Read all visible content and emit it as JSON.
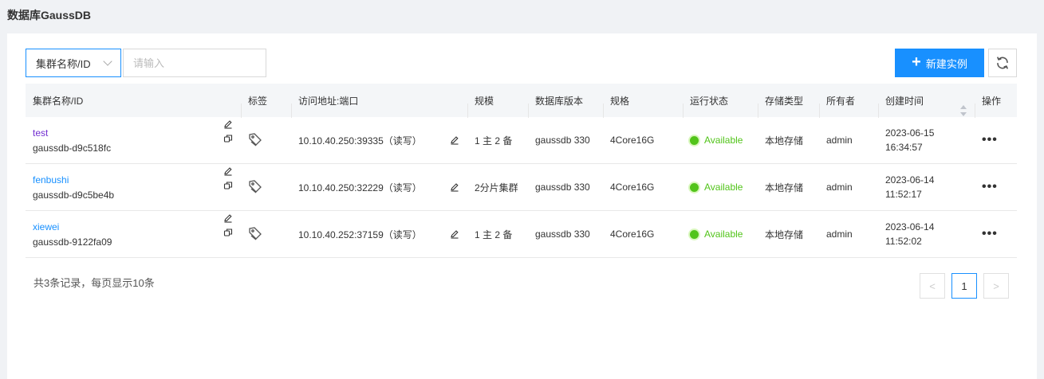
{
  "page": {
    "title": "数据库GaussDB"
  },
  "toolbar": {
    "filter_select": "集群名称/ID",
    "search_placeholder": "请输入",
    "create_label": "新建实例"
  },
  "table": {
    "headers": [
      "集群名称/ID",
      "标签",
      "访问地址:端口",
      "规模",
      "数据库版本",
      "规格",
      "运行状态",
      "存储类型",
      "所有者",
      "创建时间",
      "操作"
    ],
    "rows": [
      {
        "name": "test",
        "id": "gaussdb-d9c518fc",
        "address": "10.10.40.250:39335（读写）",
        "scale": "1 主 2 备",
        "version": "gaussdb 330",
        "spec": "4Core16G",
        "status": "Available",
        "storage": "本地存储",
        "owner": "admin",
        "date": "2023-06-15",
        "time": "16:34:57"
      },
      {
        "name": "fenbushi",
        "id": "gaussdb-d9c5be4b",
        "address": "10.10.40.250:32229（读写）",
        "scale": "2分片集群",
        "version": "gaussdb 330",
        "spec": "4Core16G",
        "status": "Available",
        "storage": "本地存储",
        "owner": "admin",
        "date": "2023-06-14",
        "time": "11:52:17"
      },
      {
        "name": "xiewei",
        "id": "gaussdb-9122fa09",
        "address": "10.10.40.252:37159（读写）",
        "scale": "1 主 2 备",
        "version": "gaussdb 330",
        "spec": "4Core16G",
        "status": "Available",
        "storage": "本地存储",
        "owner": "admin",
        "date": "2023-06-14",
        "time": "11:52:02"
      }
    ]
  },
  "footer": {
    "summary": "共3条记录，每页显示10条",
    "current_page": "1",
    "prev": "<",
    "next": ">"
  },
  "colors": {
    "primary": "#1890ff",
    "status_green": "#52c41a",
    "visited_link": "#722ed1"
  }
}
